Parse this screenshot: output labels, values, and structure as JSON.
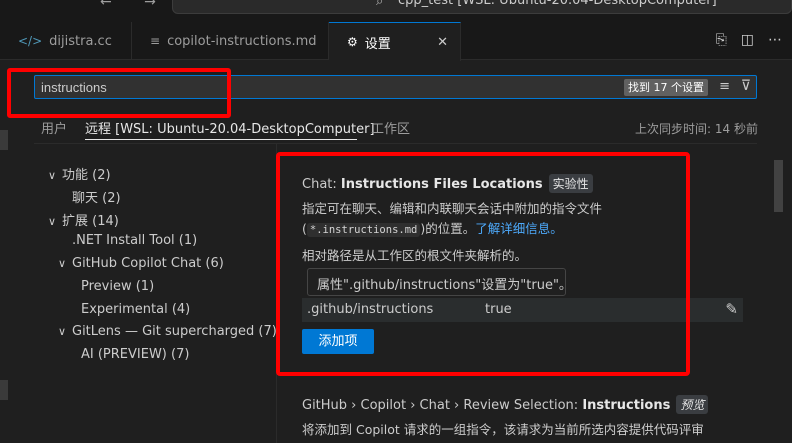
{
  "titlebar": {
    "nav": "← →",
    "title": "cpp_test [WSL: Ubuntu-20.04-DesktopComputer]"
  },
  "tabs": [
    {
      "label": "dijistra.cc",
      "icon": "cpp-file-icon"
    },
    {
      "label": "copilot-instructions.md",
      "icon": "markdown-file-icon"
    },
    {
      "label": "设置",
      "icon": "settings-icon"
    }
  ],
  "search": {
    "value": "instructions",
    "result_count": "找到 17 个设置"
  },
  "scopes": {
    "user": "用户",
    "remote": "远程 [WSL: Ubuntu-20.04-DesktopComputer]",
    "workspace": "工作区"
  },
  "sync_status": "上次同步时间: 14 秒前",
  "toc": [
    {
      "label": "功能 (2)"
    },
    {
      "label": "聊天 (2)"
    },
    {
      "label": "扩展 (14)"
    },
    {
      "label": ".NET Install Tool (1)"
    },
    {
      "label": "GitHub Copilot Chat (6)"
    },
    {
      "label": "Preview (1)"
    },
    {
      "label": "Experimental (4)"
    },
    {
      "label": "GitLens — Git supercharged (7)"
    },
    {
      "label": "AI (PREVIEW) (7)"
    }
  ],
  "setting1": {
    "category": "Chat: ",
    "name": "Instructions Files Locations",
    "tag": "实验性",
    "desc_line1": "指定可在聊天、编辑和内联聊天会话中附加的指令文件",
    "desc_open": "(",
    "code": "*.instructions.md",
    "desc_close": ")的位置。",
    "link": "了解详细信息。",
    "desc_line3": "相对路径是从工作区的根文件夹解析的。",
    "tooltip": "属性\".github/instructions\"设置为\"true\"。",
    "row_key": ".github/instructions",
    "row_value": "true",
    "add_button": "添加项"
  },
  "setting2": {
    "category": "GitHub › Copilot › Chat › Review Selection: ",
    "name": "Instructions",
    "tag": "预览",
    "desc": "将添加到 Copilot 请求的一组指令，该请求为当前所选内容提供代码评审"
  }
}
